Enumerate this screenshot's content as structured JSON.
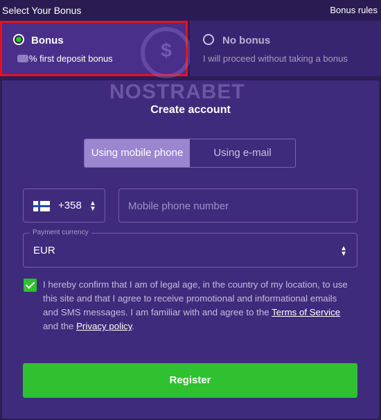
{
  "header": {
    "title": "Select Your Bonus",
    "rules_link": "Bonus rules"
  },
  "bonus_options": [
    {
      "title": "Bonus",
      "subtitle": "% first deposit bonus",
      "selected": true
    },
    {
      "title": "No bonus",
      "subtitle": "I will proceed without taking a bonus",
      "selected": false
    }
  ],
  "watermark": "NOSTRABET",
  "form": {
    "title": "Create account",
    "tabs": [
      {
        "label": "Using mobile phone",
        "active": true
      },
      {
        "label": "Using e-mail",
        "active": false
      }
    ],
    "country_code": "+358",
    "phone_placeholder": "Mobile phone number",
    "currency_label": "Payment currency",
    "currency_value": "EUR",
    "consent": {
      "checked": true,
      "text_before": "I hereby confirm that I am of legal age, in the country of my location, to use this site and that I agree to receive promotional and informational emails and SMS messages. I am familiar with and agree to the ",
      "terms_link": "Terms of Service",
      "text_middle": " and the ",
      "privacy_link": "Privacy policy",
      "text_after": "."
    },
    "register_label": "Register"
  },
  "colors": {
    "background": "#2b1d55",
    "panel": "#3f2b7c",
    "accent_green": "#2fc12f",
    "selected_border": "#e8101d"
  },
  "icons": {
    "selected_radio": "radio-checked-icon",
    "unselected_radio": "radio-unchecked-icon",
    "coin": "dollar-coin-icon",
    "flag": "finland-flag-icon",
    "select_arrows": "chevron-up-down-icon",
    "checkbox": "checkmark-icon"
  }
}
